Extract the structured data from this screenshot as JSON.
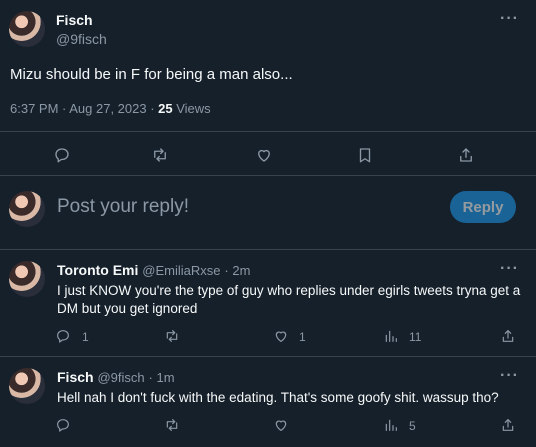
{
  "tweet": {
    "display_name": "Fisch",
    "handle": "@9fisch",
    "text": "Mizu should be in F for being a man also...",
    "time": "6:37 PM · Aug 27, 2023 · ",
    "views_count": "25",
    "views_label": " Views"
  },
  "composer": {
    "placeholder": "Post your reply!",
    "reply_label": "Reply"
  },
  "replies": [
    {
      "display_name": "Toronto Emi",
      "handle": "@EmiliaRxse",
      "age": "· 2m",
      "text": "I just KNOW you're the type of guy who replies under egirls tweets tryna get a DM but you get ignored",
      "reply_count": "1",
      "like_count": "1",
      "view_count": "11"
    },
    {
      "display_name": "Fisch",
      "handle": "@9fisch",
      "age": "· 1m",
      "text": "Hell nah I don't fuck with the edating. That's some goofy shit. wassup tho?",
      "view_count": "5"
    }
  ],
  "colors": {
    "background": "#15202b",
    "accent": "#1d9bf0",
    "muted": "#8b98a5",
    "divider": "#38444d"
  }
}
